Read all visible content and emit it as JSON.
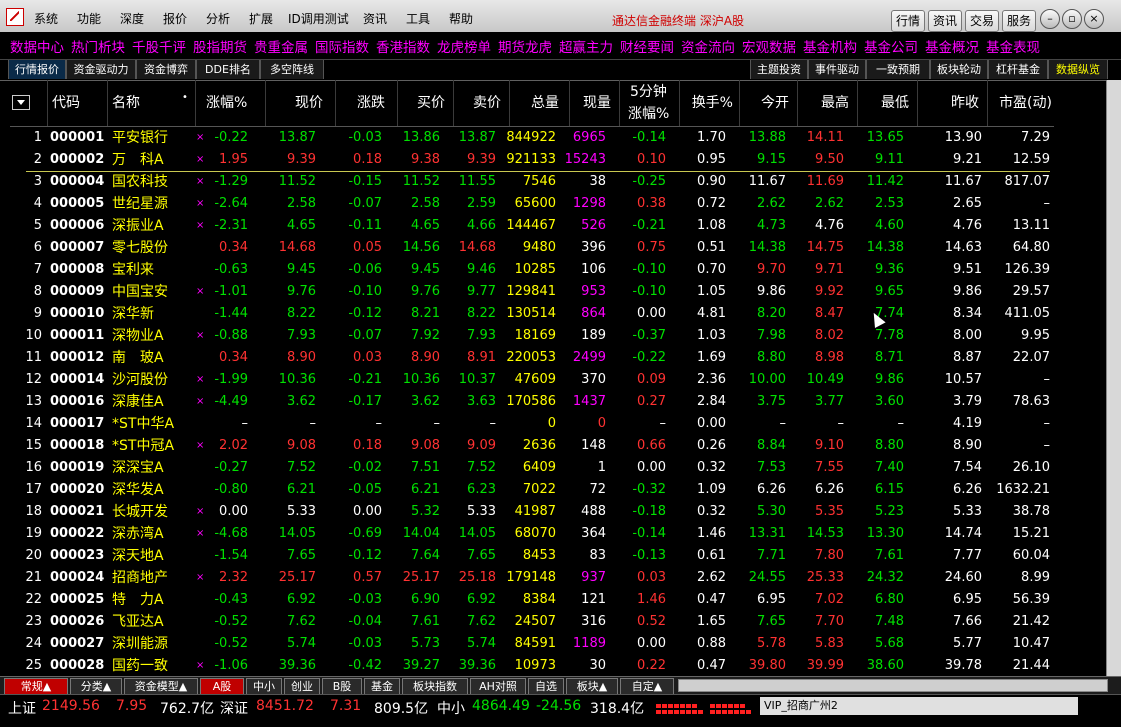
{
  "window": {
    "title": "通达信金融终端   深沪A股"
  },
  "menu": [
    "系统",
    "功能",
    "深度",
    "报价",
    "分析",
    "扩展",
    "ID调用测试",
    "资讯",
    "工具",
    "帮助"
  ],
  "title_buttons": [
    "行情",
    "资讯",
    "交易",
    "服务"
  ],
  "quickbar": [
    "数据中心",
    "热门析块",
    "千股千评",
    "股指期货",
    "贵重金属",
    "国际指数",
    "香港指数",
    "龙虎榜单",
    "期货龙虎",
    "超赢主力",
    "财经要闻",
    "资金流向",
    "宏观数据",
    "基金机构",
    "基金公司",
    "基金概况",
    "基金表现"
  ],
  "tabs_left": [
    "行情报价",
    "资金驱动力",
    "资金博弈",
    "DDE排名",
    "多空阵线"
  ],
  "tabs_right": [
    "主题投资",
    "事件驱动",
    "一致预期",
    "板块轮动",
    "杠杆基金",
    "数据纵览"
  ],
  "header": {
    "code": "代码",
    "name": "名称",
    "pct": "涨幅%",
    "price": "现价",
    "chg": "涨跌",
    "bid": "买价",
    "ask": "卖价",
    "vol": "总量",
    "cur": "现量",
    "min5_top": "5分钟",
    "min5_bot": "涨幅%",
    "turnover": "换手%",
    "open": "今开",
    "high": "最高",
    "low": "最低",
    "prev": "昨收",
    "pe": "市盈(动)"
  },
  "rows": [
    {
      "n": "1",
      "code": "000001",
      "name": "平安银行",
      "mark": "×",
      "pct": "-0.22",
      "price": "13.87",
      "chg": "-0.03",
      "bid": "13.86",
      "ask": "13.87",
      "vol": "844922",
      "cur": "6965",
      "m5": "-0.14",
      "turn": "1.70",
      "open": "13.88",
      "high": "14.11",
      "low": "13.65",
      "prev": "13.90",
      "pe": "7.29"
    },
    {
      "n": "2",
      "code": "000002",
      "name": "万　科A",
      "mark": "×",
      "pct": "1.95",
      "price": "9.39",
      "chg": "0.18",
      "bid": "9.38",
      "ask": "9.39",
      "vol": "921133",
      "cur": "15243",
      "m5": "0.10",
      "turn": "0.95",
      "open": "9.15",
      "high": "9.50",
      "low": "9.11",
      "prev": "9.21",
      "pe": "12.59"
    },
    {
      "n": "3",
      "code": "000004",
      "name": "国农科技",
      "mark": "×",
      "pct": "-1.29",
      "price": "11.52",
      "chg": "-0.15",
      "bid": "11.52",
      "ask": "11.55",
      "vol": "7546",
      "cur": "38",
      "m5": "-0.25",
      "turn": "0.90",
      "open": "11.67",
      "high": "11.69",
      "low": "11.42",
      "prev": "11.67",
      "pe": "817.07"
    },
    {
      "n": "4",
      "code": "000005",
      "name": "世纪星源",
      "mark": "×",
      "pct": "-2.64",
      "price": "2.58",
      "chg": "-0.07",
      "bid": "2.58",
      "ask": "2.59",
      "vol": "65600",
      "cur": "1298",
      "m5": "0.38",
      "turn": "0.72",
      "open": "2.62",
      "high": "2.62",
      "low": "2.53",
      "prev": "2.65",
      "pe": "–"
    },
    {
      "n": "5",
      "code": "000006",
      "name": "深振业A",
      "mark": "×",
      "pct": "-2.31",
      "price": "4.65",
      "chg": "-0.11",
      "bid": "4.65",
      "ask": "4.66",
      "vol": "144467",
      "cur": "526",
      "m5": "-0.21",
      "turn": "1.08",
      "open": "4.73",
      "high": "4.76",
      "low": "4.60",
      "prev": "4.76",
      "pe": "13.11"
    },
    {
      "n": "6",
      "code": "000007",
      "name": "零七股份",
      "mark": "",
      "pct": "0.34",
      "price": "14.68",
      "chg": "0.05",
      "bid": "14.56",
      "ask": "14.68",
      "vol": "9480",
      "cur": "396",
      "m5": "0.75",
      "turn": "0.51",
      "open": "14.38",
      "high": "14.75",
      "low": "14.38",
      "prev": "14.63",
      "pe": "64.80"
    },
    {
      "n": "7",
      "code": "000008",
      "name": "宝利来",
      "mark": "",
      "pct": "-0.63",
      "price": "9.45",
      "chg": "-0.06",
      "bid": "9.45",
      "ask": "9.46",
      "vol": "10285",
      "cur": "106",
      "m5": "-0.10",
      "turn": "0.70",
      "open": "9.70",
      "high": "9.71",
      "low": "9.36",
      "prev": "9.51",
      "pe": "126.39"
    },
    {
      "n": "8",
      "code": "000009",
      "name": "中国宝安",
      "mark": "×",
      "pct": "-1.01",
      "price": "9.76",
      "chg": "-0.10",
      "bid": "9.76",
      "ask": "9.77",
      "vol": "129841",
      "cur": "953",
      "m5": "-0.10",
      "turn": "1.05",
      "open": "9.86",
      "high": "9.92",
      "low": "9.65",
      "prev": "9.86",
      "pe": "29.57"
    },
    {
      "n": "9",
      "code": "000010",
      "name": "深华新",
      "mark": "",
      "pct": "-1.44",
      "price": "8.22",
      "chg": "-0.12",
      "bid": "8.21",
      "ask": "8.22",
      "vol": "130514",
      "cur": "864",
      "m5": "0.00",
      "turn": "4.81",
      "open": "8.20",
      "high": "8.47",
      "low": "7.74",
      "prev": "8.34",
      "pe": "411.05"
    },
    {
      "n": "10",
      "code": "000011",
      "name": "深物业A",
      "mark": "×",
      "pct": "-0.88",
      "price": "7.93",
      "chg": "-0.07",
      "bid": "7.92",
      "ask": "7.93",
      "vol": "18169",
      "cur": "189",
      "m5": "-0.37",
      "turn": "1.03",
      "open": "7.98",
      "high": "8.02",
      "low": "7.78",
      "prev": "8.00",
      "pe": "9.95"
    },
    {
      "n": "11",
      "code": "000012",
      "name": "南　玻A",
      "mark": "",
      "pct": "0.34",
      "price": "8.90",
      "chg": "0.03",
      "bid": "8.90",
      "ask": "8.91",
      "vol": "220053",
      "cur": "2499",
      "m5": "-0.22",
      "turn": "1.69",
      "open": "8.80",
      "high": "8.98",
      "low": "8.71",
      "prev": "8.87",
      "pe": "22.07"
    },
    {
      "n": "12",
      "code": "000014",
      "name": "沙河股份",
      "mark": "×",
      "pct": "-1.99",
      "price": "10.36",
      "chg": "-0.21",
      "bid": "10.36",
      "ask": "10.37",
      "vol": "47609",
      "cur": "370",
      "m5": "0.09",
      "turn": "2.36",
      "open": "10.00",
      "high": "10.49",
      "low": "9.86",
      "prev": "10.57",
      "pe": "–"
    },
    {
      "n": "13",
      "code": "000016",
      "name": "深康佳A",
      "mark": "×",
      "pct": "-4.49",
      "price": "3.62",
      "chg": "-0.17",
      "bid": "3.62",
      "ask": "3.63",
      "vol": "170586",
      "cur": "1437",
      "m5": "0.27",
      "turn": "2.84",
      "open": "3.75",
      "high": "3.77",
      "low": "3.60",
      "prev": "3.79",
      "pe": "78.63"
    },
    {
      "n": "14",
      "code": "000017",
      "name": "*ST中华A",
      "mark": "",
      "pct": "–",
      "price": "–",
      "chg": "–",
      "bid": "–",
      "ask": "–",
      "vol": "0",
      "cur": "0",
      "m5": "–",
      "turn": "0.00",
      "open": "–",
      "high": "–",
      "low": "–",
      "prev": "4.19",
      "pe": "–"
    },
    {
      "n": "15",
      "code": "000018",
      "name": "*ST中冠A",
      "mark": "×",
      "pct": "2.02",
      "price": "9.08",
      "chg": "0.18",
      "bid": "9.08",
      "ask": "9.09",
      "vol": "2636",
      "cur": "148",
      "m5": "0.66",
      "turn": "0.26",
      "open": "8.84",
      "high": "9.10",
      "low": "8.80",
      "prev": "8.90",
      "pe": "–"
    },
    {
      "n": "16",
      "code": "000019",
      "name": "深深宝A",
      "mark": "",
      "pct": "-0.27",
      "price": "7.52",
      "chg": "-0.02",
      "bid": "7.51",
      "ask": "7.52",
      "vol": "6409",
      "cur": "1",
      "m5": "0.00",
      "turn": "0.32",
      "open": "7.53",
      "high": "7.55",
      "low": "7.40",
      "prev": "7.54",
      "pe": "26.10"
    },
    {
      "n": "17",
      "code": "000020",
      "name": "深华发A",
      "mark": "",
      "pct": "-0.80",
      "price": "6.21",
      "chg": "-0.05",
      "bid": "6.21",
      "ask": "6.23",
      "vol": "7022",
      "cur": "72",
      "m5": "-0.32",
      "turn": "1.09",
      "open": "6.26",
      "high": "6.26",
      "low": "6.15",
      "prev": "6.26",
      "pe": "1632.21"
    },
    {
      "n": "18",
      "code": "000021",
      "name": "长城开发",
      "mark": "×",
      "pct": "0.00",
      "price": "5.33",
      "chg": "0.00",
      "bid": "5.32",
      "ask": "5.33",
      "vol": "41987",
      "cur": "488",
      "m5": "-0.18",
      "turn": "0.32",
      "open": "5.30",
      "high": "5.35",
      "low": "5.23",
      "prev": "5.33",
      "pe": "38.78"
    },
    {
      "n": "19",
      "code": "000022",
      "name": "深赤湾A",
      "mark": "×",
      "pct": "-4.68",
      "price": "14.05",
      "chg": "-0.69",
      "bid": "14.04",
      "ask": "14.05",
      "vol": "68070",
      "cur": "364",
      "m5": "-0.14",
      "turn": "1.46",
      "open": "13.31",
      "high": "14.53",
      "low": "13.30",
      "prev": "14.74",
      "pe": "15.21"
    },
    {
      "n": "20",
      "code": "000023",
      "name": "深天地A",
      "mark": "",
      "pct": "-1.54",
      "price": "7.65",
      "chg": "-0.12",
      "bid": "7.64",
      "ask": "7.65",
      "vol": "8453",
      "cur": "83",
      "m5": "-0.13",
      "turn": "0.61",
      "open": "7.71",
      "high": "7.80",
      "low": "7.61",
      "prev": "7.77",
      "pe": "60.04"
    },
    {
      "n": "21",
      "code": "000024",
      "name": "招商地产",
      "mark": "×",
      "pct": "2.32",
      "price": "25.17",
      "chg": "0.57",
      "bid": "25.17",
      "ask": "25.18",
      "vol": "179148",
      "cur": "937",
      "m5": "0.03",
      "turn": "2.62",
      "open": "24.55",
      "high": "25.33",
      "low": "24.32",
      "prev": "24.60",
      "pe": "8.99"
    },
    {
      "n": "22",
      "code": "000025",
      "name": "特　力A",
      "mark": "",
      "pct": "-0.43",
      "price": "6.92",
      "chg": "-0.03",
      "bid": "6.90",
      "ask": "6.92",
      "vol": "8384",
      "cur": "121",
      "m5": "1.46",
      "turn": "0.47",
      "open": "6.95",
      "high": "7.02",
      "low": "6.80",
      "prev": "6.95",
      "pe": "56.39"
    },
    {
      "n": "23",
      "code": "000026",
      "name": "飞亚达A",
      "mark": "",
      "pct": "-0.52",
      "price": "7.62",
      "chg": "-0.04",
      "bid": "7.61",
      "ask": "7.62",
      "vol": "24507",
      "cur": "316",
      "m5": "0.52",
      "turn": "1.65",
      "open": "7.65",
      "high": "7.70",
      "low": "7.48",
      "prev": "7.66",
      "pe": "21.42"
    },
    {
      "n": "24",
      "code": "000027",
      "name": "深圳能源",
      "mark": "",
      "pct": "-0.52",
      "price": "5.74",
      "chg": "-0.03",
      "bid": "5.73",
      "ask": "5.74",
      "vol": "84591",
      "cur": "1189",
      "m5": "0.00",
      "turn": "0.88",
      "open": "5.78",
      "high": "5.83",
      "low": "5.68",
      "prev": "5.77",
      "pe": "10.47"
    },
    {
      "n": "25",
      "code": "000028",
      "name": "国药一致",
      "mark": "×",
      "pct": "-1.06",
      "price": "39.36",
      "chg": "-0.42",
      "bid": "39.27",
      "ask": "39.36",
      "vol": "10973",
      "cur": "30",
      "m5": "0.22",
      "turn": "0.47",
      "open": "39.80",
      "high": "39.99",
      "low": "38.60",
      "prev": "39.78",
      "pe": "21.44"
    }
  ],
  "bottom_tabs": [
    "常规▲",
    "分类▲",
    "资金模型▲",
    "A股",
    "中小",
    "创业",
    "B股",
    "基金",
    "板块指数",
    "AH对照",
    "自选",
    "板块▲",
    "自定▲"
  ],
  "status": {
    "sh_label": "上证",
    "sh_val": "2149.56",
    "sh_chg": "7.95",
    "sh_amt": "762.7亿",
    "sz_label": "深证",
    "sz_val": "8451.72",
    "sz_chg": "7.31",
    "sz_amt": "809.5亿",
    "zx_label": "中小",
    "zx_val": "4864.49",
    "zx_chg": "-24.56",
    "zx_amt": "318.4亿",
    "vip": "VIP_招商广州2"
  },
  "colors": {
    "up": "#ff3232",
    "down": "#00e000",
    "neutral": "#ffffff",
    "name": "#ffff00",
    "volume": "#ff00ff"
  }
}
